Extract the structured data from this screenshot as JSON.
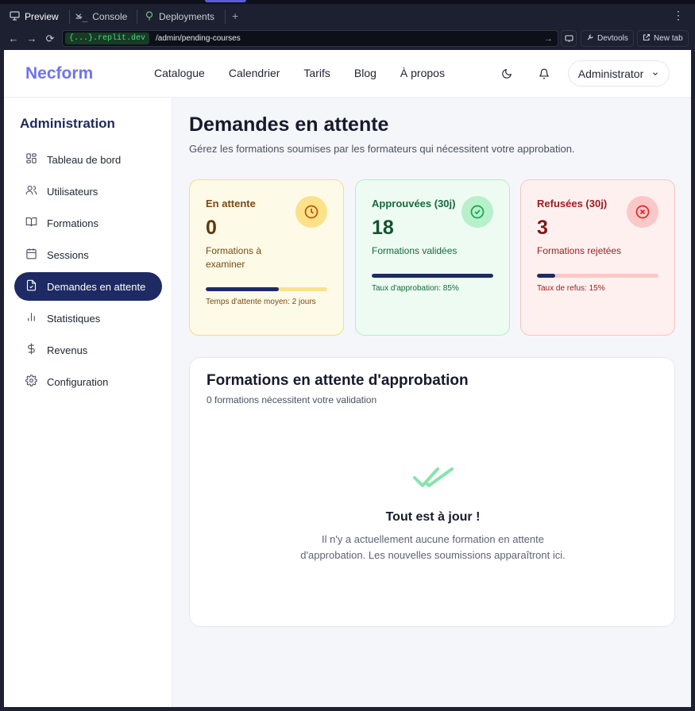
{
  "chrome": {
    "tabs": [
      {
        "label": "Preview",
        "icon": "monitor-icon"
      },
      {
        "label": "Console",
        "icon": "terminal-icon"
      },
      {
        "label": "Deployments",
        "icon": "deploy-icon"
      }
    ],
    "domain": "{...}.replit.dev",
    "path": "/admin/pending-courses",
    "devtools_label": "Devtools",
    "newtab_label": "New tab"
  },
  "header": {
    "logo": "Necform",
    "nav": [
      "Catalogue",
      "Calendrier",
      "Tarifs",
      "Blog",
      "À propos"
    ],
    "user_label": "Administrator"
  },
  "sidebar": {
    "title": "Administration",
    "items": [
      {
        "label": "Tableau de bord",
        "icon": "dashboard-icon"
      },
      {
        "label": "Utilisateurs",
        "icon": "users-icon"
      },
      {
        "label": "Formations",
        "icon": "book-icon"
      },
      {
        "label": "Sessions",
        "icon": "calendar-icon"
      },
      {
        "label": "Demandes en attente",
        "icon": "file-check-icon",
        "active": true
      },
      {
        "label": "Statistiques",
        "icon": "bar-chart-icon"
      },
      {
        "label": "Revenus",
        "icon": "dollar-icon"
      },
      {
        "label": "Configuration",
        "icon": "gear-icon"
      }
    ]
  },
  "main": {
    "title": "Demandes en attente",
    "subtitle": "Gérez les formations soumises par les formateurs qui nécessitent votre approbation.",
    "cards": {
      "pending": {
        "title": "En attente",
        "value": "0",
        "label": "Formations à examiner",
        "footer": "Temps d'attente moyen: 2 jours",
        "progress": 0.6,
        "icon": "clock-icon"
      },
      "approved": {
        "title": "Approuvées (30j)",
        "value": "18",
        "label": "Formations validées",
        "footer": "Taux d'approbation: 85%",
        "progress": 1.0,
        "icon": "check-circle-icon"
      },
      "refused": {
        "title": "Refusées (30j)",
        "value": "3",
        "label": "Formations rejetées",
        "footer": "Taux de refus: 15%",
        "progress": 0.15,
        "icon": "x-circle-icon"
      }
    },
    "panel": {
      "title": "Formations en attente d'approbation",
      "subtitle": "0 formations nécessitent votre validation",
      "empty_title": "Tout est à jour !",
      "empty_text": "Il n'y a actuellement aucune formation en attente d'approbation. Les nouvelles soumissions apparaîtront ici.",
      "empty_icon": "double-check-icon"
    }
  },
  "colors": {
    "brand": "#6f74e8",
    "nav_active": "#1e2a63",
    "pending": "#fbe28a",
    "approved": "#b7f0cb",
    "refused": "#fbc8c8"
  }
}
